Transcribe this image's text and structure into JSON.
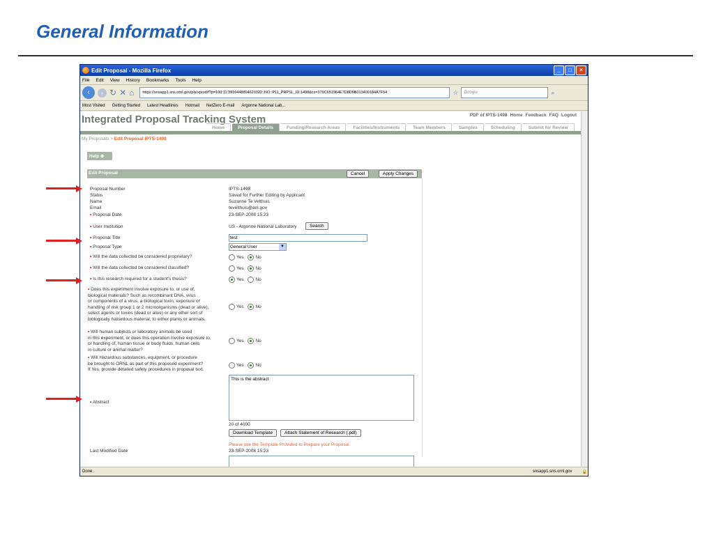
{
  "slide": {
    "title": "General Information"
  },
  "window": {
    "title": "Edit Proposal - Mozilla Firefox",
    "menu": [
      "File",
      "Edit",
      "View",
      "History",
      "Bookmarks",
      "Tools",
      "Help"
    ],
    "url": "https://snsapp1.sns.ornl.gov/pls/xprod/f?p=100:11:3910448804620322::NO::P11_PRPSL_ID:1498&cs=379C651964E7D8D6B013400184A7F54",
    "search_placeholder": "Google",
    "bookmarks": [
      "Most Visited",
      "Getting Started",
      "Latest Headlines",
      "Hotmail",
      "NetZero E-mail",
      "Argonne National Lab..."
    ],
    "status_left": "Done",
    "status_right": "snsapp1.sns.ornl.gov"
  },
  "app": {
    "title": "Integrated Proposal Tracking System",
    "top_links": [
      "PDF of IPTS-1498",
      "Home",
      "Feedback",
      "FAQ",
      "Logout"
    ],
    "tabs": [
      "Home",
      "Proposal Details",
      "Funding/Research Areas",
      "Facilities/Instruments",
      "Team Members",
      "Samples",
      "Scheduling",
      "Submit for Review"
    ],
    "active_tab": "Proposal Details",
    "breadcrumb": {
      "parent": "My Proposals",
      "sep": ">",
      "current": "Edit Proposal IPTS-1498"
    },
    "help": "Help"
  },
  "form": {
    "panel_title": "Edit Proposal",
    "cancel": "Cancel",
    "apply": "Apply Changes",
    "proposal_number_label": "Proposal Number",
    "proposal_number": "IPTS-1498",
    "status_label": "Status",
    "status": "Saved for Further Editing by Applicant",
    "name_label": "Name",
    "name": "Suzanne Te Velthuis",
    "email_label": "Email",
    "email": "tevelthuis@anl.gov",
    "date_label": "Proposal Date",
    "date": "23-SEP-2008 15:23",
    "institution_label": "User Institution",
    "institution": "US - Argonne National Laboratory",
    "search": "Search",
    "title_label": "Proposal Title",
    "title_value": "test",
    "type_label": "Proposal Type",
    "type_value": "General User",
    "q1": "Will the data collected be considered proprietary?",
    "q2": "Will the data collected be considered classified?",
    "q3": "Is this research required for a student's thesis?",
    "q4_lines": [
      "Does this experiment involve exposure to, or use of,",
      "biological materials? Such as recombinant DNA, virus",
      "or components of a virus, a biological toxin, exposure or",
      "handling of risk group 1 or 2 microorganisms (dead or alive),",
      "select agents or toxins (dead or alive) or any other sort of",
      "biologically hazardous material, to either plants or animals."
    ],
    "q5_lines": [
      "Will human subjects or laboratory animals be used",
      "in this experiment, or does this operation involve exposure to,",
      "or handling of, human tissue or body fluids, human cells",
      "in culture or animal matter?"
    ],
    "q6_lines": [
      "Will Hazardous substances, equipment, or procedure",
      "be brought to ORNL as part of this proposed experiment?",
      "If Yes, provide detailed safety procedures in proposal text."
    ],
    "yes": "Yes",
    "no": "No",
    "abstract_label": "Abstract",
    "abstract": "This is the abstract",
    "char_count": "20 of 4000",
    "download_template": "Download Template",
    "attach_statement": "Attach Statement of Research (.pdf)",
    "template_note": "Please use the Template Provided to Prepare your Proposal.",
    "last_modified_label": "Last Modified Date",
    "last_modified": "23-SEP-2008 15:23"
  },
  "colors": {
    "slide_title": "#1f5fb5",
    "arrow": "#e02020",
    "app_green": "#8fa08f",
    "required_dot": "#cc0000"
  }
}
